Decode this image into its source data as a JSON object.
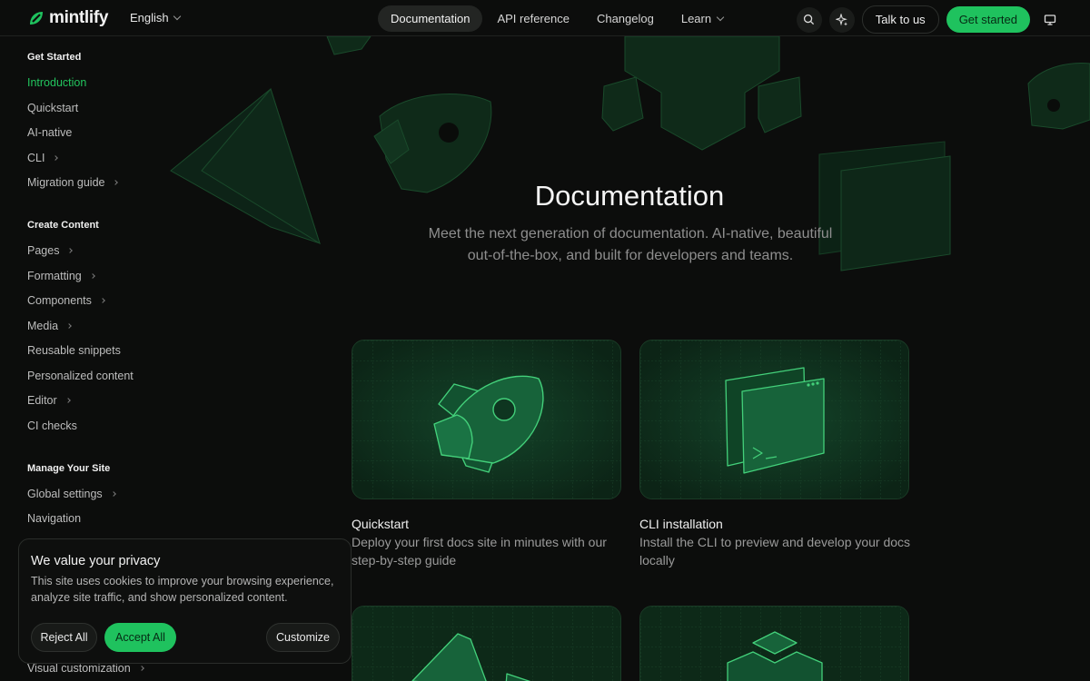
{
  "header": {
    "logo_text": "mintlify",
    "language": "English",
    "nav": [
      {
        "label": "Documentation",
        "active": true
      },
      {
        "label": "API reference",
        "active": false
      },
      {
        "label": "Changelog",
        "active": false
      },
      {
        "label": "Learn",
        "active": false
      }
    ],
    "talk_label": "Talk to us",
    "get_started_label": "Get started"
  },
  "sidebar": {
    "sections": [
      {
        "title": "Get Started",
        "items": [
          {
            "label": "Introduction",
            "active": true,
            "chevron": false
          },
          {
            "label": "Quickstart",
            "chevron": false
          },
          {
            "label": "AI-native",
            "chevron": false
          },
          {
            "label": "CLI",
            "chevron": true
          },
          {
            "label": "Migration guide",
            "chevron": true
          }
        ]
      },
      {
        "title": "Create Content",
        "items": [
          {
            "label": "Pages",
            "chevron": true
          },
          {
            "label": "Formatting",
            "chevron": true
          },
          {
            "label": "Components",
            "chevron": true
          },
          {
            "label": "Media",
            "chevron": true
          },
          {
            "label": "Reusable snippets",
            "chevron": false
          },
          {
            "label": "Personalized content",
            "chevron": false
          },
          {
            "label": "Editor",
            "chevron": true
          },
          {
            "label": "CI checks",
            "chevron": false
          }
        ]
      },
      {
        "title": "Manage Your Site",
        "items": [
          {
            "label": "Global settings",
            "chevron": true
          },
          {
            "label": "Navigation",
            "chevron": false
          },
          {
            "label": "Visual customization",
            "chevron": true
          }
        ]
      }
    ]
  },
  "hero": {
    "title": "Documentation",
    "subtitle": "Meet the next generation of documentation. AI-native, beautiful out-of-the-box, and built for developers and teams."
  },
  "cards": [
    {
      "title": "Quickstart",
      "description": "Deploy your first docs site in minutes with our step-by-step guide",
      "icon": "rocket-icon"
    },
    {
      "title": "CLI installation",
      "description": "Install the CLI to preview and develop your docs locally",
      "icon": "terminal-icon"
    },
    {
      "icon": "cursor-icon"
    },
    {
      "icon": "stack-icon"
    }
  ],
  "cookie": {
    "title": "We value your privacy",
    "text": "This site uses cookies to improve your browsing experience, analyze site traffic, and show personalized content.",
    "reject_label": "Reject All",
    "accept_label": "Accept All",
    "customize_label": "Customize"
  },
  "colors": {
    "accent": "#22c55e",
    "background": "#0c0d0c",
    "card": "#0f2a19"
  }
}
